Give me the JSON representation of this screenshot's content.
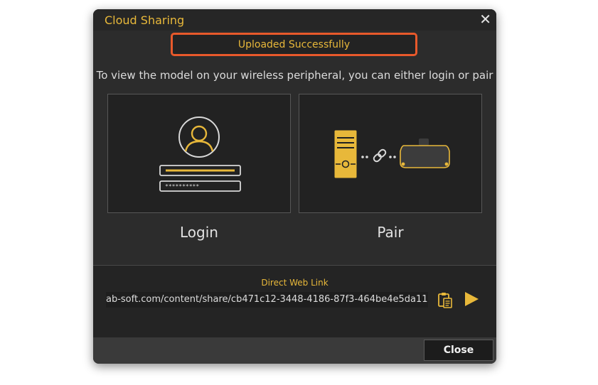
{
  "dialog": {
    "title": "Cloud Sharing",
    "close_glyph": "✕",
    "status_message": "Uploaded Successfully",
    "instruction": "To view the model on your wireless peripheral, you can either login or pair",
    "login_option": {
      "label": "Login",
      "password_mask": "**********"
    },
    "pair_option": {
      "label": "Pair"
    },
    "web_link": {
      "title": "Direct Web Link",
      "url_visible": "ab-soft.com/content/share/cb471c12-3448-4186-87f3-464be4e5da11"
    },
    "close_button_label": "Close",
    "icons": [
      "close-icon",
      "user-avatar-icon",
      "computer-tower-icon",
      "chain-link-icon",
      "vr-headset-icon",
      "clipboard-copy-icon",
      "play-icon"
    ]
  },
  "colors": {
    "accent": "#e8b83a",
    "status_border": "#e8592b",
    "dialog_bg": "#2c2c2c",
    "panel_bg": "#222222"
  }
}
